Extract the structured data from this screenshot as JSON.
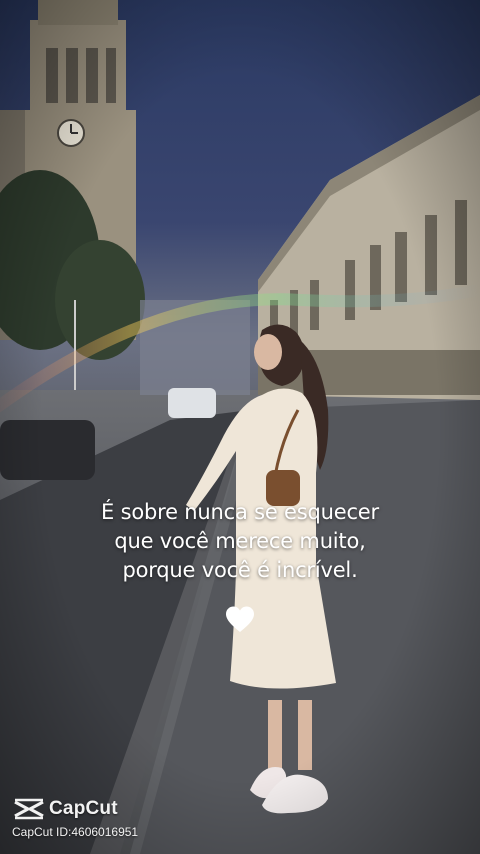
{
  "caption": {
    "lines": [
      "É sobre nunca se esquecer",
      "que você merece muito,",
      "porque você é incrível."
    ]
  },
  "heart_icon": "white-heart-icon",
  "watermark": {
    "logo_icon": "capcut-logo-icon",
    "name": "CapCut",
    "id_text": "CapCut ID:4606016951"
  },
  "colors": {
    "sky": "#34406a",
    "caption_text": "#ffffff",
    "dress": "#efe6d8"
  }
}
